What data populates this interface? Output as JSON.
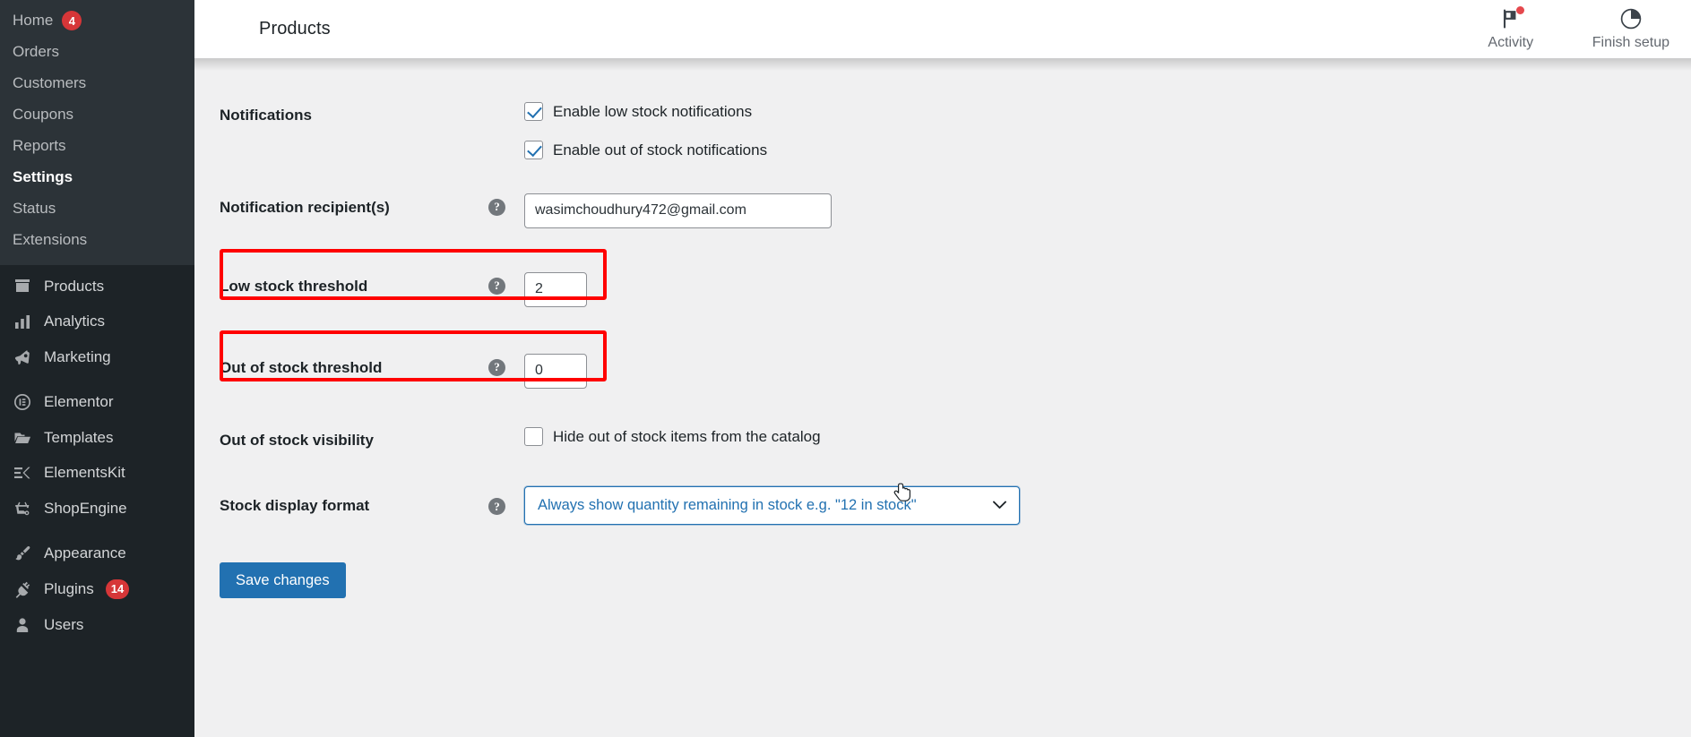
{
  "sidebar": {
    "submenu": [
      {
        "label": "Home",
        "badge": "4",
        "current": false
      },
      {
        "label": "Orders",
        "badge": "",
        "current": false
      },
      {
        "label": "Customers",
        "badge": "",
        "current": false
      },
      {
        "label": "Coupons",
        "badge": "",
        "current": false
      },
      {
        "label": "Reports",
        "badge": "",
        "current": false
      },
      {
        "label": "Settings",
        "badge": "",
        "current": true
      },
      {
        "label": "Status",
        "badge": "",
        "current": false
      },
      {
        "label": "Extensions",
        "badge": "",
        "current": false
      }
    ],
    "menu_group_1": [
      {
        "label": "Products",
        "icon": "products-box-icon",
        "badge": ""
      },
      {
        "label": "Analytics",
        "icon": "bar-chart-icon",
        "badge": ""
      },
      {
        "label": "Marketing",
        "icon": "megaphone-icon",
        "badge": ""
      }
    ],
    "menu_group_2": [
      {
        "label": "Elementor",
        "icon": "elementor-circle-icon",
        "badge": ""
      },
      {
        "label": "Templates",
        "icon": "folder-icon",
        "badge": ""
      },
      {
        "label": "ElementsKit",
        "icon": "elementskit-icon",
        "badge": ""
      },
      {
        "label": "ShopEngine",
        "icon": "shopengine-basket-icon",
        "badge": ""
      }
    ],
    "menu_group_3": [
      {
        "label": "Appearance",
        "icon": "paintbrush-icon",
        "badge": ""
      },
      {
        "label": "Plugins",
        "icon": "plug-icon",
        "badge": "14"
      },
      {
        "label": "Users",
        "icon": "user-icon",
        "badge": ""
      }
    ]
  },
  "topbar": {
    "title": "Products",
    "activity_label": "Activity",
    "finish_setup_label": "Finish setup"
  },
  "settings": {
    "notifications": {
      "label": "Notifications",
      "low_stock": {
        "label": "Enable low stock notifications",
        "checked": true
      },
      "out_of_stock": {
        "label": "Enable out of stock notifications",
        "checked": true
      }
    },
    "recipients": {
      "label": "Notification recipient(s)",
      "value": "wasimchoudhury472@gmail.com",
      "help": "?"
    },
    "low_stock_threshold": {
      "label": "Low stock threshold",
      "value": "2",
      "help": "?",
      "highlighted": true
    },
    "out_of_stock_threshold": {
      "label": "Out of stock threshold",
      "value": "0",
      "help": "?",
      "highlighted": true
    },
    "out_of_stock_visibility": {
      "label": "Out of stock visibility",
      "checkbox_label": "Hide out of stock items from the catalog",
      "checked": false
    },
    "stock_display_format": {
      "label": "Stock display format",
      "help": "?",
      "selected": "Always show quantity remaining in stock e.g. \"12 in stock\"",
      "chevron": "⌄"
    },
    "save_button": "Save changes"
  },
  "colors": {
    "sidebar_bg": "#1d2327",
    "submenu_bg": "#2c3338",
    "accent_blue": "#2271b1",
    "badge_red": "#d63638",
    "annotation_red": "#ff0000",
    "content_bg": "#f0f0f1"
  }
}
